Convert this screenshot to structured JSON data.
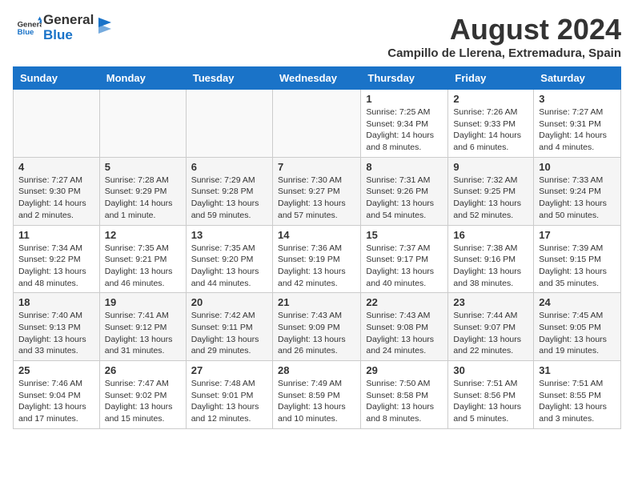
{
  "header": {
    "logo_general": "General",
    "logo_blue": "Blue",
    "month_year": "August 2024",
    "location": "Campillo de Llerena, Extremadura, Spain"
  },
  "weekdays": [
    "Sunday",
    "Monday",
    "Tuesday",
    "Wednesday",
    "Thursday",
    "Friday",
    "Saturday"
  ],
  "weeks": [
    [
      {
        "day": "",
        "info": ""
      },
      {
        "day": "",
        "info": ""
      },
      {
        "day": "",
        "info": ""
      },
      {
        "day": "",
        "info": ""
      },
      {
        "day": "1",
        "info": "Sunrise: 7:25 AM\nSunset: 9:34 PM\nDaylight: 14 hours\nand 8 minutes."
      },
      {
        "day": "2",
        "info": "Sunrise: 7:26 AM\nSunset: 9:33 PM\nDaylight: 14 hours\nand 6 minutes."
      },
      {
        "day": "3",
        "info": "Sunrise: 7:27 AM\nSunset: 9:31 PM\nDaylight: 14 hours\nand 4 minutes."
      }
    ],
    [
      {
        "day": "4",
        "info": "Sunrise: 7:27 AM\nSunset: 9:30 PM\nDaylight: 14 hours\nand 2 minutes."
      },
      {
        "day": "5",
        "info": "Sunrise: 7:28 AM\nSunset: 9:29 PM\nDaylight: 14 hours\nand 1 minute."
      },
      {
        "day": "6",
        "info": "Sunrise: 7:29 AM\nSunset: 9:28 PM\nDaylight: 13 hours\nand 59 minutes."
      },
      {
        "day": "7",
        "info": "Sunrise: 7:30 AM\nSunset: 9:27 PM\nDaylight: 13 hours\nand 57 minutes."
      },
      {
        "day": "8",
        "info": "Sunrise: 7:31 AM\nSunset: 9:26 PM\nDaylight: 13 hours\nand 54 minutes."
      },
      {
        "day": "9",
        "info": "Sunrise: 7:32 AM\nSunset: 9:25 PM\nDaylight: 13 hours\nand 52 minutes."
      },
      {
        "day": "10",
        "info": "Sunrise: 7:33 AM\nSunset: 9:24 PM\nDaylight: 13 hours\nand 50 minutes."
      }
    ],
    [
      {
        "day": "11",
        "info": "Sunrise: 7:34 AM\nSunset: 9:22 PM\nDaylight: 13 hours\nand 48 minutes."
      },
      {
        "day": "12",
        "info": "Sunrise: 7:35 AM\nSunset: 9:21 PM\nDaylight: 13 hours\nand 46 minutes."
      },
      {
        "day": "13",
        "info": "Sunrise: 7:35 AM\nSunset: 9:20 PM\nDaylight: 13 hours\nand 44 minutes."
      },
      {
        "day": "14",
        "info": "Sunrise: 7:36 AM\nSunset: 9:19 PM\nDaylight: 13 hours\nand 42 minutes."
      },
      {
        "day": "15",
        "info": "Sunrise: 7:37 AM\nSunset: 9:17 PM\nDaylight: 13 hours\nand 40 minutes."
      },
      {
        "day": "16",
        "info": "Sunrise: 7:38 AM\nSunset: 9:16 PM\nDaylight: 13 hours\nand 38 minutes."
      },
      {
        "day": "17",
        "info": "Sunrise: 7:39 AM\nSunset: 9:15 PM\nDaylight: 13 hours\nand 35 minutes."
      }
    ],
    [
      {
        "day": "18",
        "info": "Sunrise: 7:40 AM\nSunset: 9:13 PM\nDaylight: 13 hours\nand 33 minutes."
      },
      {
        "day": "19",
        "info": "Sunrise: 7:41 AM\nSunset: 9:12 PM\nDaylight: 13 hours\nand 31 minutes."
      },
      {
        "day": "20",
        "info": "Sunrise: 7:42 AM\nSunset: 9:11 PM\nDaylight: 13 hours\nand 29 minutes."
      },
      {
        "day": "21",
        "info": "Sunrise: 7:43 AM\nSunset: 9:09 PM\nDaylight: 13 hours\nand 26 minutes."
      },
      {
        "day": "22",
        "info": "Sunrise: 7:43 AM\nSunset: 9:08 PM\nDaylight: 13 hours\nand 24 minutes."
      },
      {
        "day": "23",
        "info": "Sunrise: 7:44 AM\nSunset: 9:07 PM\nDaylight: 13 hours\nand 22 minutes."
      },
      {
        "day": "24",
        "info": "Sunrise: 7:45 AM\nSunset: 9:05 PM\nDaylight: 13 hours\nand 19 minutes."
      }
    ],
    [
      {
        "day": "25",
        "info": "Sunrise: 7:46 AM\nSunset: 9:04 PM\nDaylight: 13 hours\nand 17 minutes."
      },
      {
        "day": "26",
        "info": "Sunrise: 7:47 AM\nSunset: 9:02 PM\nDaylight: 13 hours\nand 15 minutes."
      },
      {
        "day": "27",
        "info": "Sunrise: 7:48 AM\nSunset: 9:01 PM\nDaylight: 13 hours\nand 12 minutes."
      },
      {
        "day": "28",
        "info": "Sunrise: 7:49 AM\nSunset: 8:59 PM\nDaylight: 13 hours\nand 10 minutes."
      },
      {
        "day": "29",
        "info": "Sunrise: 7:50 AM\nSunset: 8:58 PM\nDaylight: 13 hours\nand 8 minutes."
      },
      {
        "day": "30",
        "info": "Sunrise: 7:51 AM\nSunset: 8:56 PM\nDaylight: 13 hours\nand 5 minutes."
      },
      {
        "day": "31",
        "info": "Sunrise: 7:51 AM\nSunset: 8:55 PM\nDaylight: 13 hours\nand 3 minutes."
      }
    ]
  ]
}
